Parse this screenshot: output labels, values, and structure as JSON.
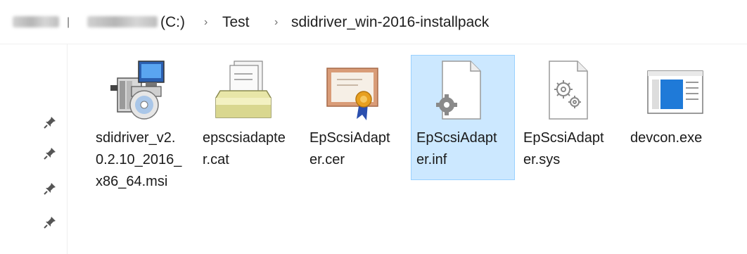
{
  "breadcrumb": {
    "drive_label": "(C:)",
    "segments": [
      "Test",
      "sdidriver_win-2016-installpack"
    ],
    "separator": "›"
  },
  "nav": {
    "pin_icons": [
      "pin-icon",
      "pin-icon",
      "pin-icon",
      "pin-icon"
    ]
  },
  "files": [
    {
      "name": "sdidriver_v2.0.2.10_2016_x86_64.msi",
      "icon": "installer-msi-icon",
      "selected": false
    },
    {
      "name": "epscsiadapter.cat",
      "icon": "security-catalog-icon",
      "selected": false
    },
    {
      "name": "EpScsiAdapter.cer",
      "icon": "certificate-icon",
      "selected": false
    },
    {
      "name": "EpScsiAdapter.inf",
      "icon": "setup-information-icon",
      "selected": true
    },
    {
      "name": "EpScsiAdapter.sys",
      "icon": "system-file-icon",
      "selected": false
    },
    {
      "name": "devcon.exe",
      "icon": "application-exe-icon",
      "selected": false
    }
  ],
  "colors": {
    "selection_fill": "#cce8ff",
    "selection_border": "#99d1ff"
  }
}
